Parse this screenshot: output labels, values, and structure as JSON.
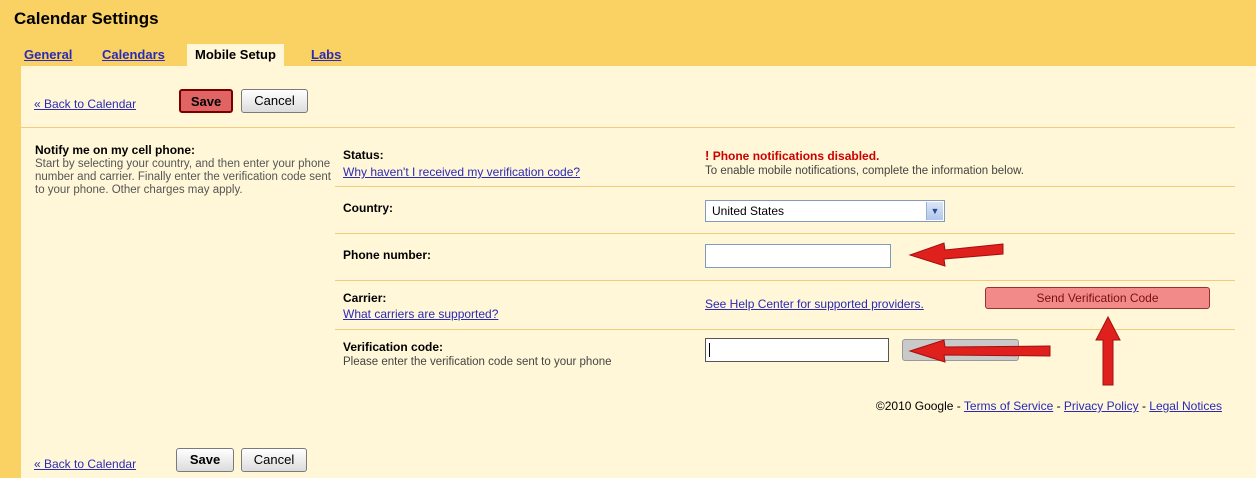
{
  "header": {
    "title": "Calendar Settings",
    "tabs": [
      "General",
      "Calendars",
      "Mobile Setup",
      "Labs"
    ]
  },
  "toolbar": {
    "back_label": "« Back to Calendar",
    "save_label": "Save",
    "cancel_label": "Cancel"
  },
  "left": {
    "title": "Notify me on my cell phone:",
    "description": "Start by selecting your country, and then enter your phone number and carrier. Finally enter the verification code sent to your phone. Other charges may apply."
  },
  "status": {
    "label": "Status:",
    "link": "Why haven't I received my verification code?",
    "value": "Phone notifications disabled.",
    "note": "To enable mobile notifications, complete the information below."
  },
  "country": {
    "label": "Country:",
    "value": "United States"
  },
  "phone": {
    "label": "Phone number:",
    "value": ""
  },
  "carrier": {
    "label": "Carrier:",
    "link": "What carriers are supported?",
    "help_link": "See Help Center for supported providers.",
    "send_label": "Send Verification Code"
  },
  "verification": {
    "label": "Verification code:",
    "hint": "Please enter the verification code sent to your phone",
    "value": ""
  },
  "footer": {
    "copyright": "©2010 Google - ",
    "terms": "Terms of Service",
    "privacy": "Privacy Policy",
    "legal": "Legal Notices",
    "sep": " - "
  },
  "colors": {
    "header_bg": "#fad163",
    "panel_bg": "#fff7d7",
    "link": "#2a2ab8",
    "alert_red": "#cc0000",
    "annotation_arrow": "#e0201c"
  },
  "icons": [
    "alert-icon",
    "chevron-down-icon",
    "annotation-arrow"
  ]
}
